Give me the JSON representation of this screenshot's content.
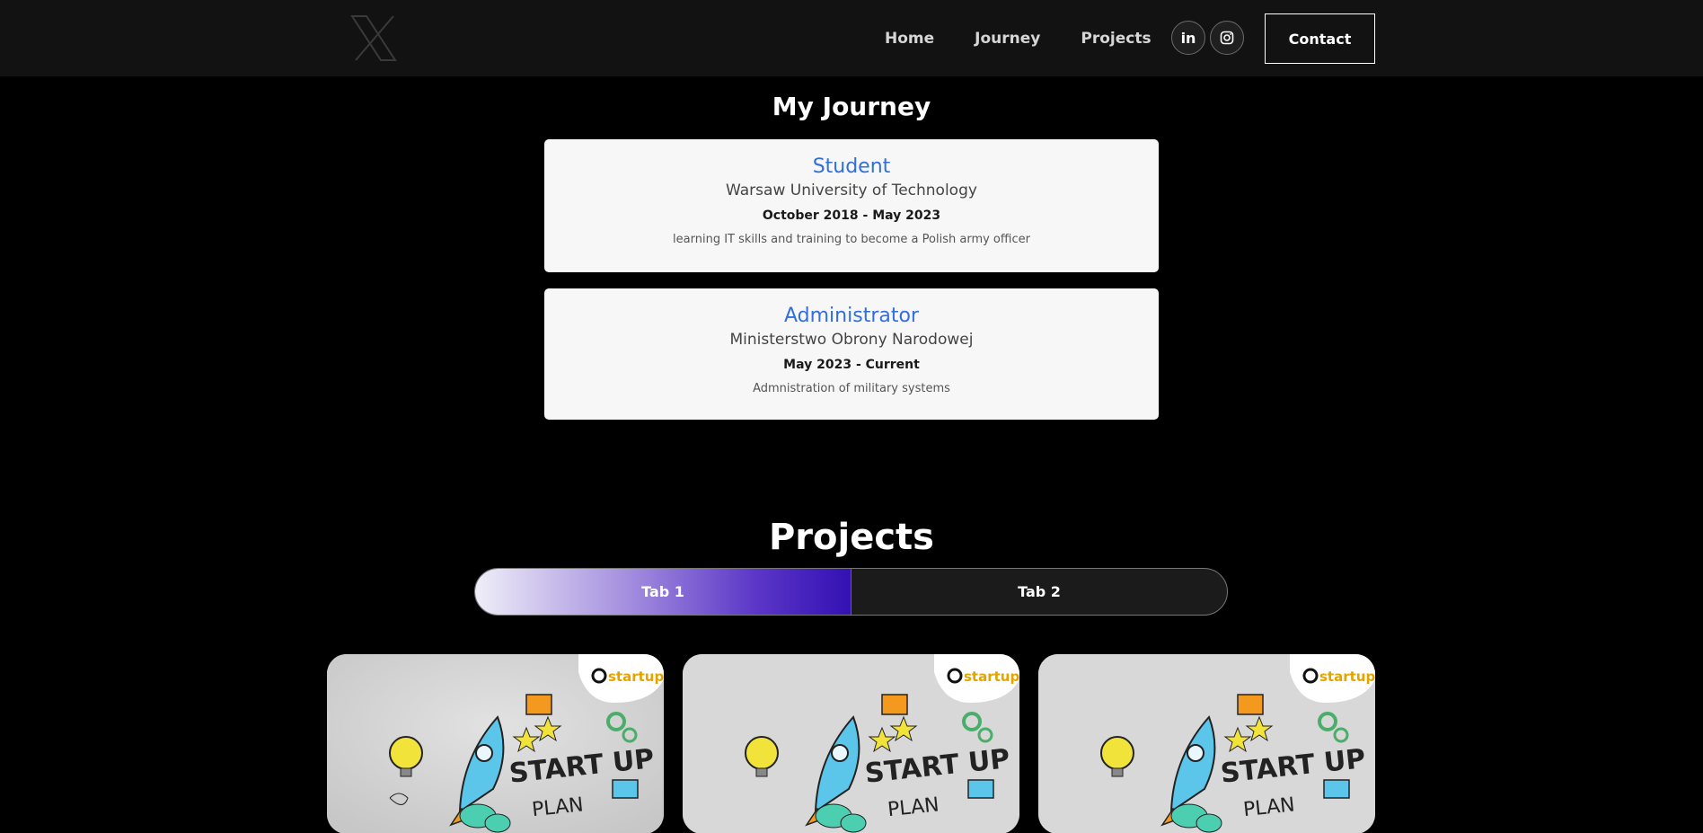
{
  "nav": {
    "logo_icon": "x-logo-icon",
    "links": [
      "Home",
      "Journey",
      "Projects"
    ],
    "social": [
      {
        "name": "linkedin-icon",
        "label": "in"
      },
      {
        "name": "instagram-icon"
      }
    ],
    "contact_label": "Contact"
  },
  "journey": {
    "title": "My Journey",
    "items": [
      {
        "role": "Student",
        "organization": "Warsaw University of Technology",
        "dates": "October 2018 - May 2023",
        "description": "learning IT skills and training to become a Polish army officer"
      },
      {
        "role": "Administrator",
        "organization": "Ministerstwo Obrony Narodowej",
        "dates": "May 2023 - Current",
        "description": "Admnistration of military systems"
      }
    ]
  },
  "projects": {
    "title": "Projects",
    "tabs": [
      "Tab 1",
      "Tab 2"
    ],
    "active_tab": "Tab 1",
    "cards": [
      {
        "image": "startup-plan-illustration",
        "art_text": [
          "START UP",
          "PLAN",
          "startup"
        ]
      },
      {
        "image": "startup-plan-illustration",
        "art_text": [
          "START UP",
          "PLAN",
          "startup"
        ]
      },
      {
        "image": "startup-plan-illustration",
        "art_text": [
          "START UP",
          "PLAN",
          "startup"
        ]
      }
    ]
  },
  "colors": {
    "nav_bg": "#121212",
    "page_bg": "#000000",
    "card_bg": "#f7f7f7",
    "role_blue": "#2f6fe0",
    "tab_gradient_end": "#3311b3"
  }
}
